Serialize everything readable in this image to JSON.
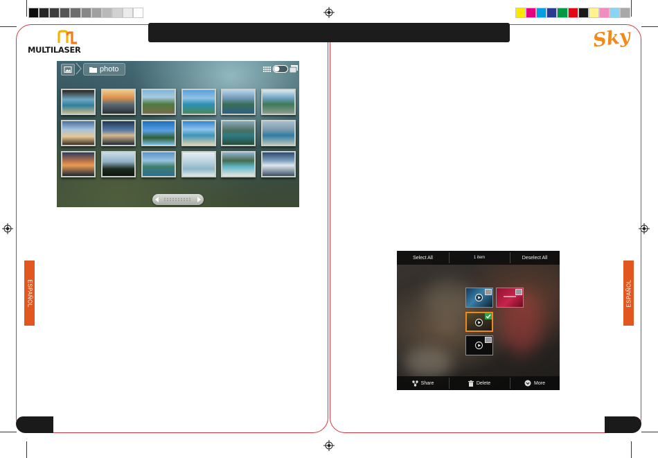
{
  "colors": {
    "frame_border": "#d9343f",
    "side_tab": "#e2561f",
    "header_bar": "#1c1c1c",
    "sky_logo": "#f18a1e",
    "multilaser_text": "#1a1a1a",
    "selected_highlight": "#f08a1c",
    "check_green": "#2fa14d"
  },
  "color_bar_left": [
    "#0d0d0d",
    "#262626",
    "#3d3d3d",
    "#555555",
    "#6e6e6e",
    "#878787",
    "#a0a0a0",
    "#b9b9b9",
    "#d2d2d2",
    "#ebebeb",
    "#ffffff"
  ],
  "color_bar_right": [
    "#ffe600",
    "#e5007e",
    "#00a0e3",
    "#2a3a8f",
    "#009a44",
    "#e30613",
    "#1a1a1a",
    "#fff38a",
    "#f28cc0",
    "#8ad4f4",
    "#a8a8a8"
  ],
  "logos": {
    "multilaser": "MULTILASER",
    "sky": "Sky"
  },
  "side_tabs": {
    "left": "ESPAÑOL",
    "right": "ESPAÑOL"
  },
  "gallery_screen": {
    "folder_label": "photo",
    "icons": [
      "gallery-home-icon",
      "folder-icon",
      "grid-view-icon",
      "view-toggle-icon",
      "slideshow-icon"
    ]
  },
  "selection_screen": {
    "select_all": "Select All",
    "item_count": "1 item",
    "deselect_all": "Deselect All",
    "share": "Share",
    "delete": "Delete",
    "more": "More",
    "icons": [
      "share-icon",
      "trash-icon",
      "more-icon",
      "play-icon",
      "check-icon"
    ]
  }
}
